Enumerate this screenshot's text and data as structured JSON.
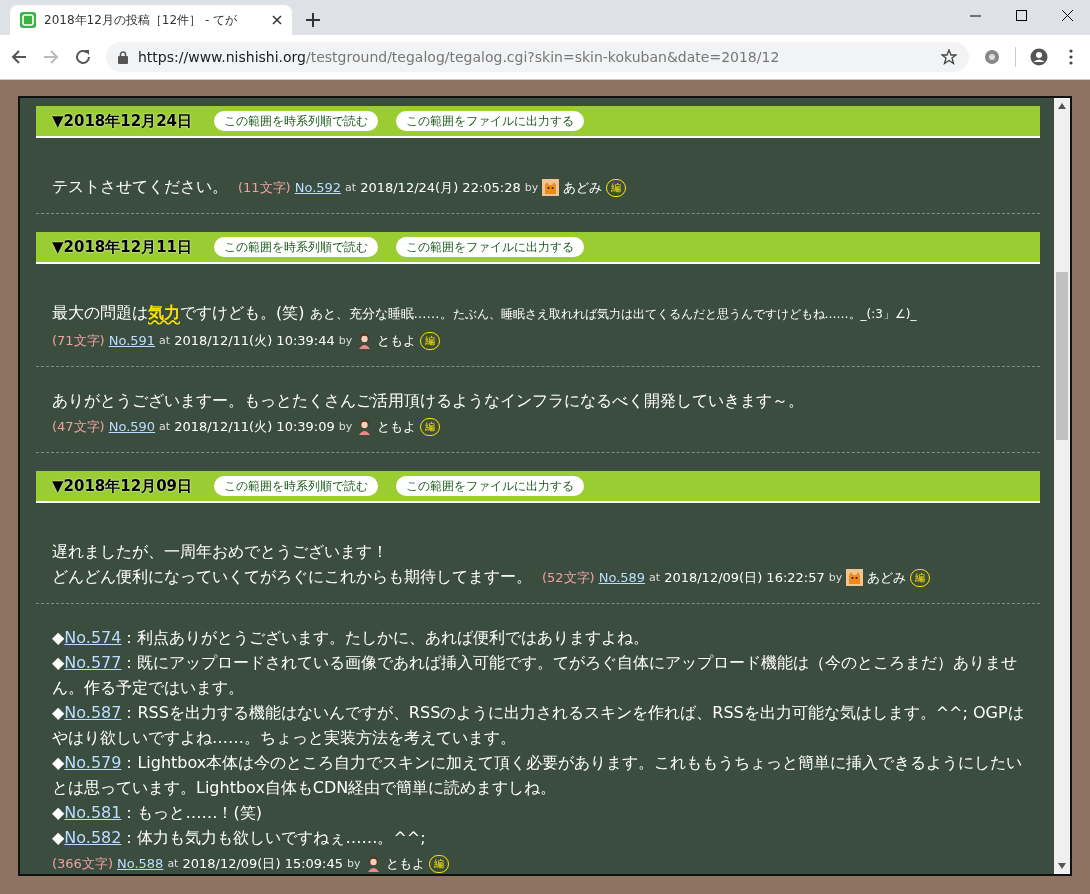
{
  "browser": {
    "tab_title": "2018年12月の投稿［12件］ - てが",
    "url_host": "https://www.nishishi.org",
    "url_path": "/testground/tegalog/tegalog.cgi?skin=skin-kokuban&date=2018/12"
  },
  "days": [
    {
      "heading": "▼2018年12月24日",
      "buttons": [
        "この範囲を時系列順で読む",
        "この範囲をファイルに出力する"
      ],
      "posts": [
        {
          "meta_inline": true,
          "lines": [
            [
              {
                "kind": "text",
                "text": "テストさせてください。"
              }
            ]
          ],
          "count": "(11文字)",
          "number": "No.592",
          "at": "at",
          "date": "2018/12/24(月) 22:05:28",
          "by": "by",
          "author": {
            "kind": "cat",
            "name": "あどみ"
          },
          "edit": "編"
        }
      ]
    },
    {
      "heading": "▼2018年12月11日",
      "buttons": [
        "この範囲を時系列順で読む",
        "この範囲をファイルに出力する"
      ],
      "posts": [
        {
          "meta_inline": false,
          "lines": [
            [
              {
                "kind": "text",
                "text": "最大の問題は"
              },
              {
                "kind": "mark",
                "text": "気力"
              },
              {
                "kind": "text",
                "text": "ですけども。(笑) "
              },
              {
                "kind": "small",
                "text": "あと、充分な睡眠……。"
              },
              {
                "kind": "tiny",
                "text": "たぶん、睡眠さえ取れれば気力は出てくるんだと思うんですけどもね……。_(:3」∠)_"
              }
            ]
          ],
          "count": "(71文字)",
          "number": "No.591",
          "at": "at",
          "date": "2018/12/11(火) 10:39:44",
          "by": "by",
          "author": {
            "kind": "person",
            "name": "ともよ"
          },
          "edit": "編"
        },
        {
          "meta_inline": false,
          "lines": [
            [
              {
                "kind": "text",
                "text": "ありがとうございますー。もっとたくさんご活用頂けるようなインフラになるべく開発していきます～。"
              }
            ]
          ],
          "count": "(47文字)",
          "number": "No.590",
          "at": "at",
          "date": "2018/12/11(火) 10:39:09",
          "by": "by",
          "author": {
            "kind": "person",
            "name": "ともよ"
          },
          "edit": "編"
        }
      ]
    },
    {
      "heading": "▼2018年12月09日",
      "buttons": [
        "この範囲を時系列順で読む",
        "この範囲をファイルに出力する"
      ],
      "posts": [
        {
          "meta_inline": true,
          "lines": [
            [
              {
                "kind": "text",
                "text": "遅れましたが、一周年おめでとうございます！"
              }
            ],
            [
              {
                "kind": "text",
                "text": "どんどん便利になっていくてがろぐにこれからも期待してますー。"
              }
            ]
          ],
          "count": "(52文字)",
          "number": "No.589",
          "at": "at",
          "date": "2018/12/09(日) 16:22:57",
          "by": "by",
          "author": {
            "kind": "cat",
            "name": "あどみ"
          },
          "edit": "編"
        },
        {
          "meta_inline": false,
          "lines": [
            [
              {
                "kind": "text",
                "text": "◆"
              },
              {
                "kind": "link",
                "text": "No.574"
              },
              {
                "kind": "text",
                "text": "：利点ありがとうございます。たしかに、あれば便利ではありますよね。"
              }
            ],
            [
              {
                "kind": "text",
                "text": "◆"
              },
              {
                "kind": "link",
                "text": "No.577"
              },
              {
                "kind": "text",
                "text": "：既にアップロードされている画像であれば挿入可能です。てがろぐ自体にアップロード機能は（今のところまだ）ありません。作る予定ではいます。"
              }
            ],
            [
              {
                "kind": "text",
                "text": "◆"
              },
              {
                "kind": "link",
                "text": "No.587"
              },
              {
                "kind": "text",
                "text": "：RSSを出力する機能はないんですが、RSSのように出力されるスキンを作れば、RSSを出力可能な気はします。^^; OGPはやはり欲しいですよね……。ちょっと実装方法を考えています。"
              }
            ],
            [
              {
                "kind": "text",
                "text": "◆"
              },
              {
                "kind": "link",
                "text": "No.579"
              },
              {
                "kind": "text",
                "text": "：Lightbox本体は今のところ自力でスキンに加えて頂く必要があります。これももうちょっと簡単に挿入できるようにしたいとは思っています。Lightbox自体もCDN経由で簡単に読めますしね。"
              }
            ],
            [
              {
                "kind": "text",
                "text": "◆"
              },
              {
                "kind": "link",
                "text": "No.581"
              },
              {
                "kind": "text",
                "text": "：もっと……！(笑)"
              }
            ],
            [
              {
                "kind": "text",
                "text": "◆"
              },
              {
                "kind": "link",
                "text": "No.582"
              },
              {
                "kind": "text",
                "text": "：体力も気力も欲しいですねぇ……。^^;"
              }
            ]
          ],
          "count": "(366文字)",
          "number": "No.588",
          "at": "at",
          "date": "2018/12/09(日) 15:09:45",
          "by": "by",
          "author": {
            "kind": "person",
            "name": "ともよ"
          },
          "edit": "編"
        }
      ]
    }
  ]
}
